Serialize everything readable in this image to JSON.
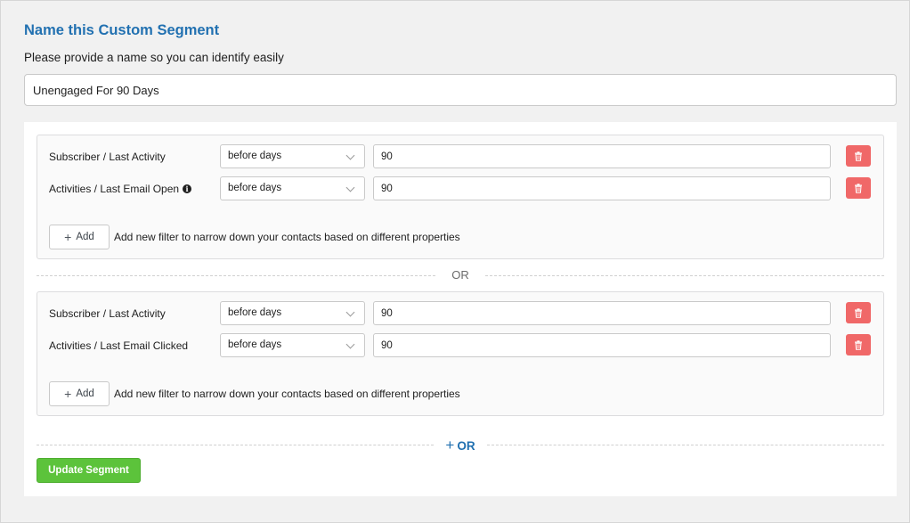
{
  "header": {
    "title": "Name this Custom Segment",
    "subtitle": "Please provide a name so you can identify easily"
  },
  "segment_name": {
    "value": "Unengaged For 90 Days"
  },
  "groups": [
    {
      "filters": [
        {
          "label": "Subscriber / Last Activity",
          "operator": "before days",
          "value": "90",
          "has_info": false
        },
        {
          "label": "Activities / Last Email Open",
          "operator": "before days",
          "value": "90",
          "has_info": true
        }
      ],
      "add_label": "Add",
      "add_hint": "Add new filter to narrow down your contacts based on different properties"
    },
    {
      "filters": [
        {
          "label": "Subscriber / Last Activity",
          "operator": "before days",
          "value": "90",
          "has_info": false
        },
        {
          "label": "Activities / Last Email Clicked",
          "operator": "before days",
          "value": "90",
          "has_info": false
        }
      ],
      "add_label": "Add",
      "add_hint": "Add new filter to narrow down your contacts based on different properties"
    }
  ],
  "or_separator": "OR",
  "add_or_label": "OR",
  "update_button": "Update Segment",
  "colors": {
    "title": "#2271b1",
    "delete": "#f06868",
    "update": "#5cc33b",
    "add_or": "#2271b1"
  },
  "icons": {
    "delete": "trash-icon",
    "add": "plus-icon",
    "select": "chevron-down-icon",
    "info": "info-icon"
  }
}
